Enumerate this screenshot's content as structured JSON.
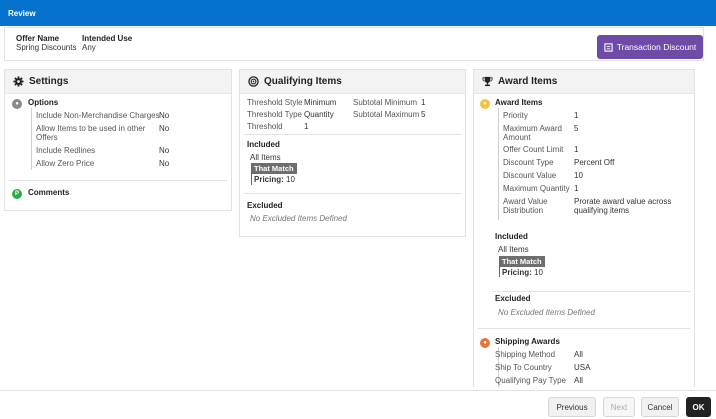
{
  "header": {
    "title": "Review"
  },
  "summary": {
    "offer_name_label": "Offer Name",
    "offer_name_value": "Spring Discounts",
    "intended_use_label": "Intended Use",
    "intended_use_value": "Any",
    "type_button": "Transaction Discount"
  },
  "settings": {
    "title": "Settings",
    "options_title": "Options",
    "rows": [
      {
        "label": "Include Non-Merchandise Charges",
        "value": "No"
      },
      {
        "label": "Allow Items to be used in other Offers",
        "value": "No"
      },
      {
        "label": "Include Redlines",
        "value": "No"
      },
      {
        "label": "Allow Zero Price",
        "value": "No"
      }
    ],
    "comments_title": "Comments"
  },
  "qualifying": {
    "title": "Qualifying Items",
    "threshold_style_label": "Threshold Style",
    "threshold_style_value": "Minimum",
    "threshold_type_label": "Threshold Type",
    "threshold_type_value": "Quantity",
    "threshold_label": "Threshold",
    "threshold_value": "1",
    "subtotal_min_label": "Subtotal Minimum",
    "subtotal_min_value": "1",
    "subtotal_max_label": "Subtotal Maximum",
    "subtotal_max_value": "5",
    "included_title": "Included",
    "all_items": "All Items",
    "that_match": "That Match",
    "pricing_label": "Pricing:",
    "pricing_value": "10",
    "excluded_title": "Excluded",
    "no_excluded": "No Excluded Items Defined"
  },
  "award": {
    "title": "Award Items",
    "items_title": "Award Items",
    "rows": [
      {
        "label": "Priority",
        "value": "1"
      },
      {
        "label": "Maximum Award Amount",
        "value": "5"
      },
      {
        "label": "Offer Count Limit",
        "value": "1"
      },
      {
        "label": "Discount Type",
        "value": "Percent Off"
      },
      {
        "label": "Discount Value",
        "value": "10"
      },
      {
        "label": "Maximum Quantity",
        "value": "1"
      },
      {
        "label": "Award Value Distribution",
        "value": "Prorate award value across qualifying items"
      }
    ],
    "included_title": "Included",
    "all_items": "All Items",
    "that_match": "That Match",
    "pricing_label": "Pricing:",
    "pricing_value": "10",
    "excluded_title": "Excluded",
    "no_excluded": "No Excluded Items Defined",
    "shipping_title": "Shipping Awards",
    "shipping_rows": [
      {
        "label": "Shipping Method",
        "value": "All"
      },
      {
        "label": "Ship To Country",
        "value": "USA"
      },
      {
        "label": "Qualifying Pay Type",
        "value": "All"
      }
    ]
  },
  "footer": {
    "previous": "Previous",
    "next": "Next",
    "cancel": "Cancel",
    "ok": "OK"
  },
  "colors": {
    "header": "#0572ce",
    "type_button": "#6f4ba8",
    "options_icon": "#8a8a8a",
    "comments_icon": "#2eaa4a",
    "award_icon": "#f5c242",
    "shipping_icon": "#e8743b"
  }
}
